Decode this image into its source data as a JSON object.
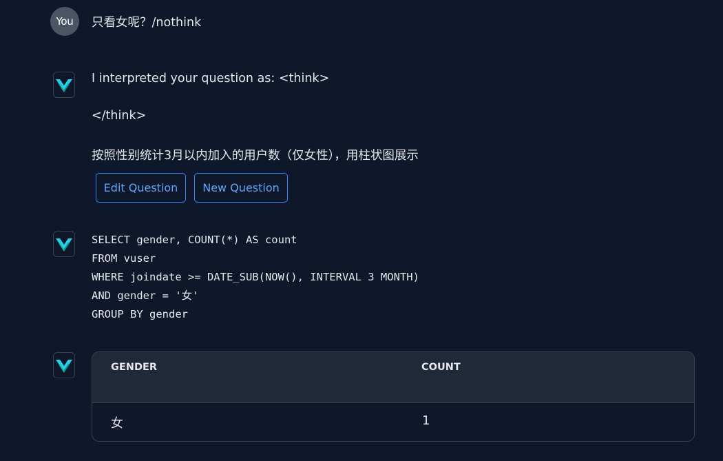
{
  "user_message": {
    "avatar_label": "You",
    "text": "只看女呢？/nothink"
  },
  "interpretation_message": {
    "line1": "I interpreted your question as: <think>",
    "line2": "</think>",
    "line3": "按照性别统计3月以内加入的用户数（仅女性），用柱状图展示",
    "buttons": {
      "edit_label": "Edit Question",
      "new_label": "New Question"
    }
  },
  "sql_message": {
    "lines": [
      "SELECT gender, COUNT(*) AS count",
      "FROM vuser",
      "WHERE joindate >= DATE_SUB(NOW(), INTERVAL 3 MONTH)",
      "AND gender = '女'",
      "GROUP BY gender"
    ]
  },
  "result_table": {
    "columns": [
      "GENDER",
      "COUNT"
    ],
    "rows": [
      [
        "女",
        "1"
      ]
    ]
  },
  "icons": {
    "user_avatar": "user-avatar",
    "bot_avatar": "vanna-logo-icon"
  },
  "colors": {
    "background": "#0f172a",
    "logo_teal": "#22d3ee",
    "logo_green": "#14b8a6",
    "button_accent": "#3b82f6"
  }
}
